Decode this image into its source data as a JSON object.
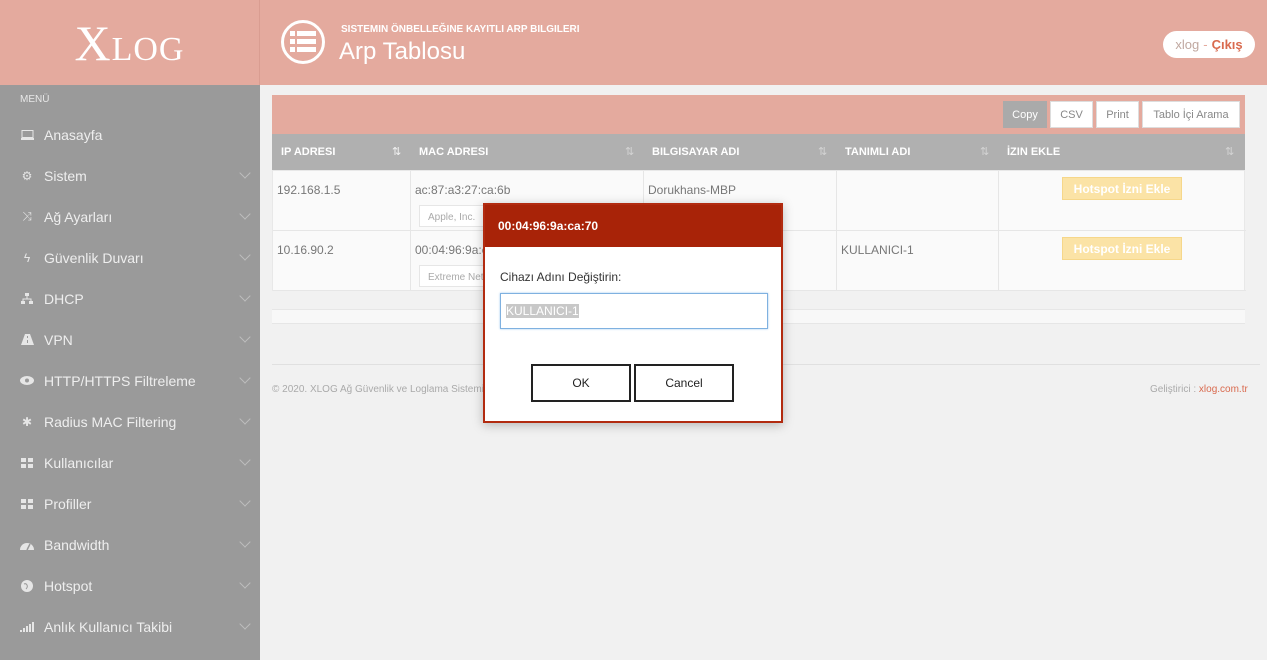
{
  "header": {
    "logo": "XLOG",
    "subtitle": "SISTEMIN ÖNBELLEĞINE KAYITLI ARP BILGILERI",
    "title": "Arp Tablosu",
    "user": "xlog",
    "separator": "-",
    "logout": "Çıkış"
  },
  "sidebar": {
    "menu_label": "MENÜ",
    "items": [
      {
        "label": "Anasayfa",
        "icon": "laptop-icon"
      },
      {
        "label": "Sistem",
        "icon": "cogs-icon"
      },
      {
        "label": "Ağ Ayarları",
        "icon": "shuffle-icon"
      },
      {
        "label": "Güvenlik Duvarı",
        "icon": "bolt-icon"
      },
      {
        "label": "DHCP",
        "icon": "sitemap-icon"
      },
      {
        "label": "VPN",
        "icon": "road-icon"
      },
      {
        "label": "HTTP/HTTPS Filtreleme",
        "icon": "eye-icon"
      },
      {
        "label": "Radius MAC Filtering",
        "icon": "asterisk-icon"
      },
      {
        "label": "Kullanıcılar",
        "icon": "grid-icon"
      },
      {
        "label": "Profiller",
        "icon": "grid-icon"
      },
      {
        "label": "Bandwidth",
        "icon": "dashboard-icon"
      },
      {
        "label": "Hotspot",
        "icon": "globe-icon"
      },
      {
        "label": "Anlık Kullanıcı Takibi",
        "icon": "signal-icon"
      }
    ]
  },
  "toolbar": {
    "copy": "Copy",
    "csv": "CSV",
    "print": "Print",
    "search": "Tablo İçi Arama"
  },
  "table": {
    "headers": [
      "IP ADRESI",
      "MAC ADRESI",
      "BILGISAYAR ADI",
      "TANIMLI ADI",
      "İZIN EKLE"
    ],
    "rows": [
      {
        "ip": "192.168.1.5",
        "mac": "ac:87:a3:27:ca:6b",
        "vendor": "Apple, Inc.",
        "hostname": "Dorukhans-MBP",
        "alias": "",
        "action": "Hotspot İzni Ekle"
      },
      {
        "ip": "10.16.90.2",
        "mac": "00:04:96:9a:ca:70",
        "vendor": "Extreme Networks",
        "hostname": "",
        "alias": "KULLANICI-1",
        "action": "Hotspot İzni Ekle"
      }
    ]
  },
  "footer": {
    "copyright": "© 2020. XLOG Ağ Güvenlik ve Loglama Sistemi",
    "dev_label": "Geliştirici :",
    "dev_link": "xlog.com.tr"
  },
  "dialog": {
    "title": "00:04:96:9a:ca:70",
    "prompt": "Cihazı Adını Değiştirin:",
    "value": "KULLANICI-1",
    "ok": "OK",
    "cancel": "Cancel"
  },
  "colors": {
    "header": "#e4aa9e",
    "sidebar": "#9a9a9a",
    "dialog_header": "#a82308",
    "accent": "#d96a4e"
  }
}
